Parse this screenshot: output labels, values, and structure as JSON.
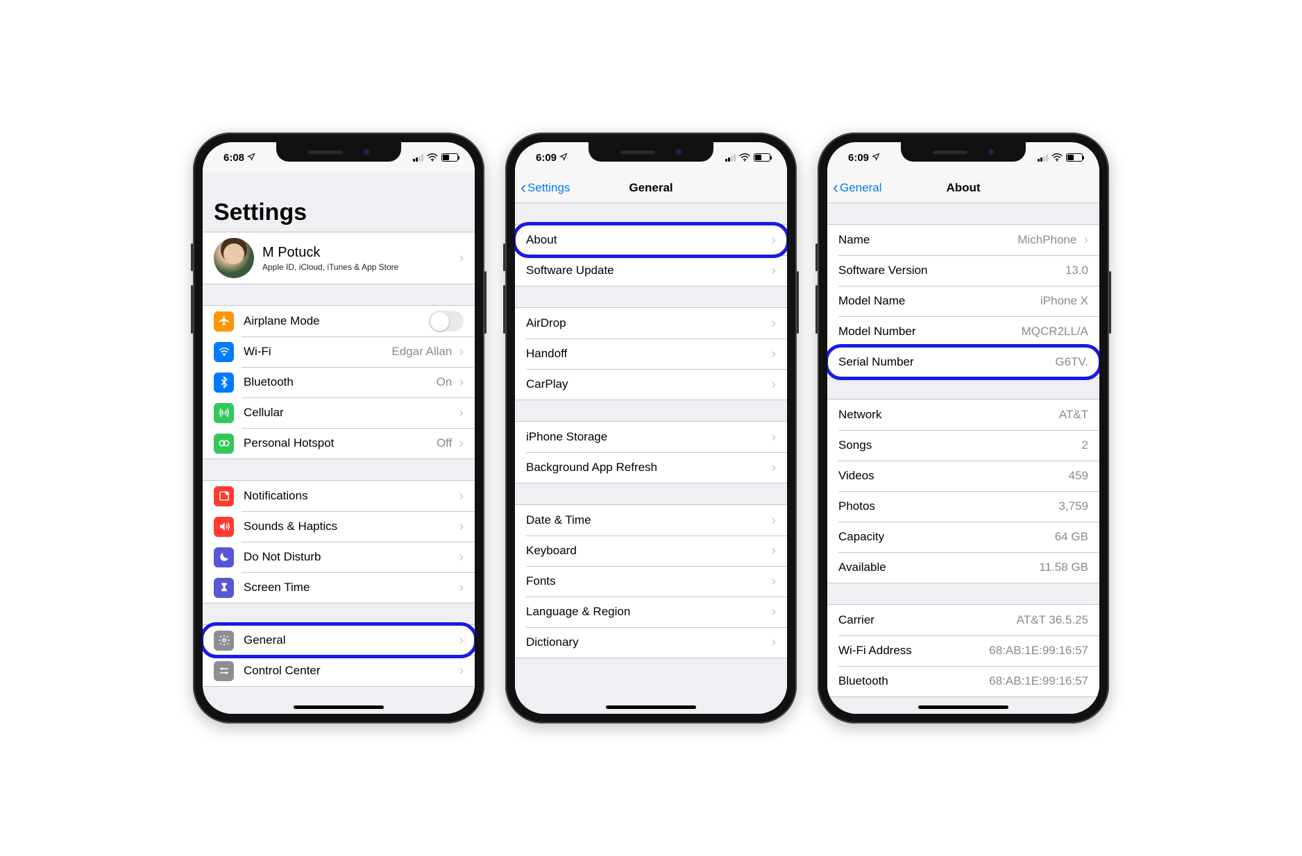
{
  "colors": {
    "orange": "#ff9500",
    "blue": "#007aff",
    "green": "#34c759",
    "red": "#ff3b30",
    "purple": "#5856d6",
    "grey": "#8e8e93"
  },
  "screen1": {
    "time": "6:08",
    "title": "Settings",
    "profile": {
      "name": "M Potuck",
      "subtitle": "Apple ID, iCloud, iTunes & App Store"
    },
    "group2": [
      {
        "icon": "airplane",
        "color": "#ff9500",
        "label": "Airplane Mode",
        "control": "switch"
      },
      {
        "icon": "wifi",
        "color": "#007aff",
        "label": "Wi-Fi",
        "value": "Edgar Allan",
        "chevron": true
      },
      {
        "icon": "bluetooth",
        "color": "#007aff",
        "label": "Bluetooth",
        "value": "On",
        "chevron": true
      },
      {
        "icon": "cellular",
        "color": "#34c759",
        "label": "Cellular",
        "chevron": true
      },
      {
        "icon": "hotspot",
        "color": "#34c759",
        "label": "Personal Hotspot",
        "value": "Off",
        "chevron": true
      }
    ],
    "group3": [
      {
        "icon": "notif",
        "color": "#ff3b30",
        "label": "Notifications",
        "chevron": true
      },
      {
        "icon": "sound",
        "color": "#ff3b30",
        "label": "Sounds & Haptics",
        "chevron": true
      },
      {
        "icon": "moon",
        "color": "#5856d6",
        "label": "Do Not Disturb",
        "chevron": true
      },
      {
        "icon": "hourglass",
        "color": "#5856d6",
        "label": "Screen Time",
        "chevron": true
      }
    ],
    "group4": [
      {
        "icon": "gear",
        "color": "#8e8e93",
        "label": "General",
        "chevron": true,
        "highlight": true
      },
      {
        "icon": "sliders",
        "color": "#8e8e93",
        "label": "Control Center",
        "chevron": true
      }
    ]
  },
  "screen2": {
    "time": "6:09",
    "back": "Settings",
    "title": "General",
    "groups": [
      [
        {
          "label": "About",
          "chevron": true,
          "highlight": true
        },
        {
          "label": "Software Update",
          "chevron": true
        }
      ],
      [
        {
          "label": "AirDrop",
          "chevron": true
        },
        {
          "label": "Handoff",
          "chevron": true
        },
        {
          "label": "CarPlay",
          "chevron": true
        }
      ],
      [
        {
          "label": "iPhone Storage",
          "chevron": true
        },
        {
          "label": "Background App Refresh",
          "chevron": true
        }
      ],
      [
        {
          "label": "Date & Time",
          "chevron": true
        },
        {
          "label": "Keyboard",
          "chevron": true
        },
        {
          "label": "Fonts",
          "chevron": true
        },
        {
          "label": "Language & Region",
          "chevron": true
        },
        {
          "label": "Dictionary",
          "chevron": true
        }
      ]
    ]
  },
  "screen3": {
    "time": "6:09",
    "back": "General",
    "title": "About",
    "groups": [
      [
        {
          "label": "Name",
          "value": "MichPhone",
          "chevron": true
        },
        {
          "label": "Software Version",
          "value": "13.0"
        },
        {
          "label": "Model Name",
          "value": "iPhone X"
        },
        {
          "label": "Model Number",
          "value": "MQCR2LL/A"
        },
        {
          "label": "Serial Number",
          "value": "G6TV.",
          "highlight": true
        }
      ],
      [
        {
          "label": "Network",
          "value": "AT&T"
        },
        {
          "label": "Songs",
          "value": "2"
        },
        {
          "label": "Videos",
          "value": "459"
        },
        {
          "label": "Photos",
          "value": "3,759"
        },
        {
          "label": "Capacity",
          "value": "64 GB"
        },
        {
          "label": "Available",
          "value": "11.58 GB"
        }
      ],
      [
        {
          "label": "Carrier",
          "value": "AT&T 36.5.25"
        },
        {
          "label": "Wi-Fi Address",
          "value": "68:AB:1E:99:16:57"
        },
        {
          "label": "Bluetooth",
          "value": "68:AB:1E:99:16:57"
        }
      ]
    ]
  }
}
